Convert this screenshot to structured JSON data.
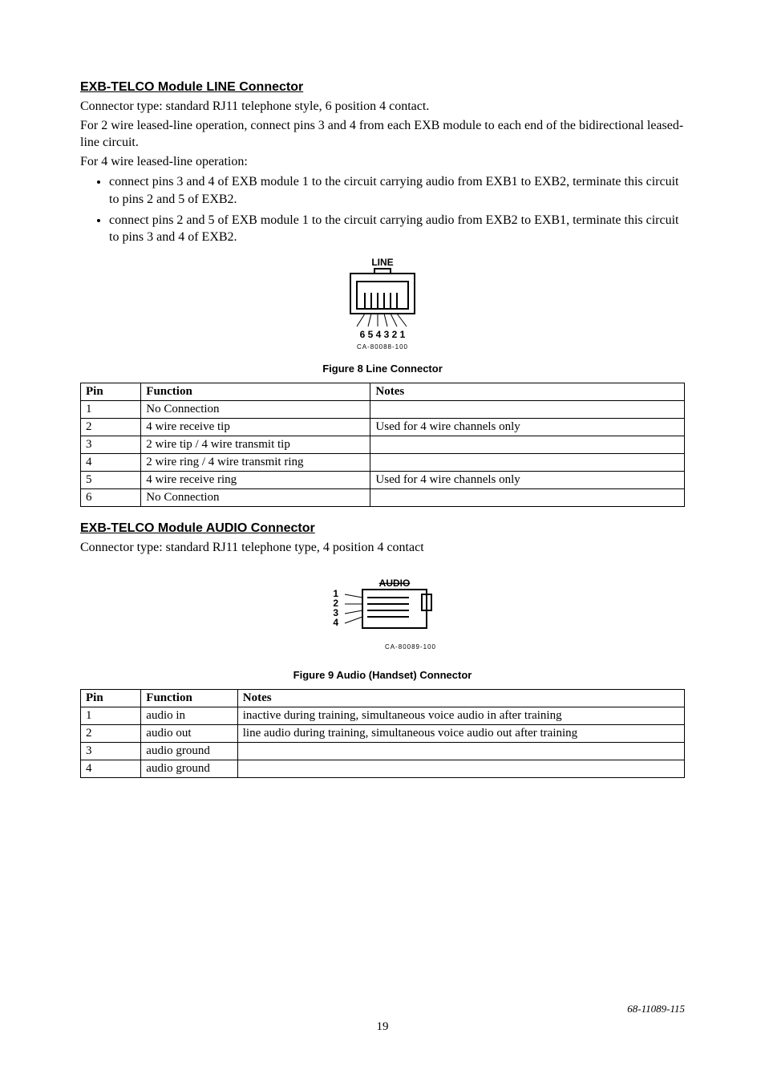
{
  "section1": {
    "heading": "EXB-TELCO Module LINE Connector",
    "p1": "Connector type: standard RJ11 telephone style, 6 position 4 contact.",
    "p2": "For 2 wire leased-line operation, connect pins 3 and 4 from each EXB module to each end of the bidirectional leased-line circuit.",
    "p3": "For 4 wire leased-line operation:",
    "bullets": [
      "connect pins 3 and 4 of EXB module 1 to the circuit carrying audio from EXB1 to EXB2, terminate this circuit to pins 2 and 5 of EXB2.",
      "connect pins 2 and 5 of EXB module 1 to the circuit carrying audio from EXB2 to EXB1, terminate this circuit to pins 3 and 4 of EXB2."
    ],
    "fig_label_top": "LINE",
    "fig_pins": "6 5 4 3 2 1",
    "fig_part": "CA-80088-100",
    "fig_caption": "Figure 8  Line Connector",
    "table": {
      "headers": [
        "Pin",
        "Function",
        "Notes"
      ],
      "rows": [
        [
          "1",
          "No Connection",
          ""
        ],
        [
          "2",
          "4 wire receive tip",
          "Used for 4 wire channels only"
        ],
        [
          "3",
          "2 wire tip / 4 wire transmit tip",
          ""
        ],
        [
          "4",
          "2 wire ring / 4 wire transmit ring",
          ""
        ],
        [
          "5",
          "4 wire receive ring",
          "Used for 4 wire channels only"
        ],
        [
          "6",
          "No Connection",
          ""
        ]
      ]
    }
  },
  "section2": {
    "heading": "EXB-TELCO Module AUDIO Connector",
    "p1": "Connector type: standard RJ11 telephone type, 4 position 4 contact",
    "fig_label_top": "AUDIO",
    "fig_pins": [
      "1",
      "2",
      "3",
      "4"
    ],
    "fig_part": "CA-80089-100",
    "fig_caption": "Figure 9  Audio (Handset) Connector",
    "table": {
      "headers": [
        "Pin",
        "Function",
        "Notes"
      ],
      "rows": [
        [
          "1",
          "audio in",
          "inactive during training, simultaneous voice audio in after training"
        ],
        [
          "2",
          "audio out",
          "line audio during training, simultaneous voice audio out after training"
        ],
        [
          "3",
          "audio ground",
          ""
        ],
        [
          "4",
          "audio ground",
          ""
        ]
      ]
    }
  },
  "footer": {
    "docnum": "68-11089-115",
    "page": "19"
  }
}
